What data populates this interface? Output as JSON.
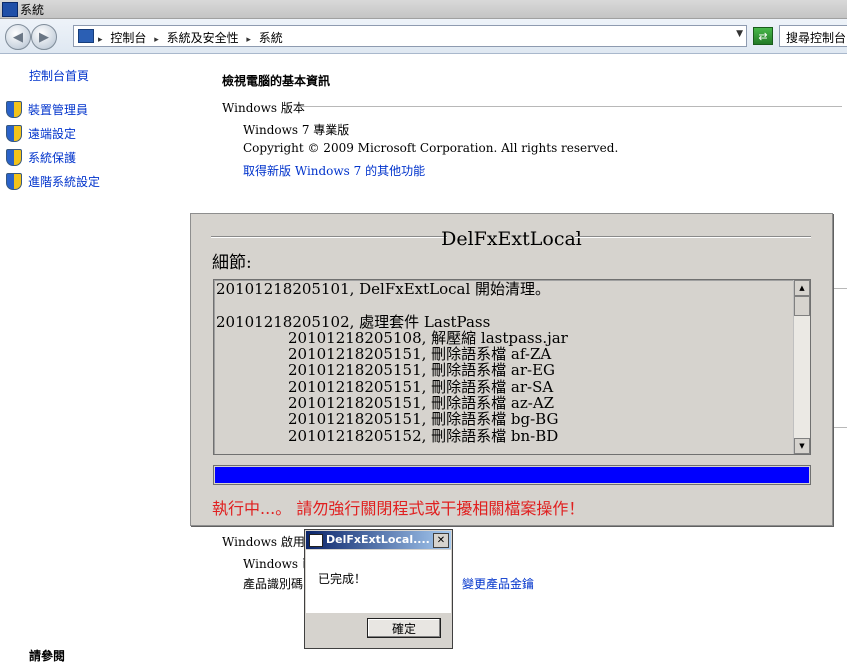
{
  "window": {
    "title": "系統"
  },
  "address_bar": {
    "crumbs": [
      "控制台",
      "系統及安全性",
      "系統"
    ],
    "search_placeholder": "搜尋控制台"
  },
  "left_nav": {
    "home": "控制台首頁",
    "items": [
      "裝置管理員",
      "遠端設定",
      "系統保護",
      "進階系統設定"
    ],
    "see_also": "請參閱"
  },
  "main": {
    "heading": "檢視電腦的基本資訊",
    "windows_edition": {
      "label": "Windows 版本",
      "edition": "Windows 7 專業版",
      "copyright": "Copyright © 2009 Microsoft Corporation.  All rights reserved.",
      "more_link": "取得新版 Windows 7 的其他功能"
    },
    "activation": {
      "label": "Windows 啟用",
      "status": "Windows 已",
      "product_id_label": "產品識別碼",
      "change_key_link": "變更產品金鑰"
    }
  },
  "dialog": {
    "title": "DelFxExtLocal",
    "details_label": "細節:",
    "log": [
      {
        "text": "20101218205101, DelFxExtLocal 開始清理。",
        "indent": false
      },
      {
        "text": "",
        "indent": false
      },
      {
        "text": "20101218205102, 處理套件 LastPass",
        "indent": false
      },
      {
        "text": "20101218205108, 解壓縮 lastpass.jar",
        "indent": true
      },
      {
        "text": "20101218205151, 刪除語系檔 af-ZA",
        "indent": true
      },
      {
        "text": "20101218205151, 刪除語系檔 ar-EG",
        "indent": true
      },
      {
        "text": "20101218205151, 刪除語系檔 ar-SA",
        "indent": true
      },
      {
        "text": "20101218205151, 刪除語系檔 az-AZ",
        "indent": true
      },
      {
        "text": "20101218205151, 刪除語系檔 bg-BG",
        "indent": true
      },
      {
        "text": "20101218205152, 刪除語系檔 bn-BD",
        "indent": true
      }
    ],
    "progress_fraction": 1.0,
    "progress_color": "#0000ff",
    "status": "執行中...。 請勿強行關閉程式或干擾相關檔案操作！",
    "status_color": "#e02020"
  },
  "message_box": {
    "title": "DelFxExtLocal....",
    "text": "已完成！",
    "ok_label": "確定"
  }
}
